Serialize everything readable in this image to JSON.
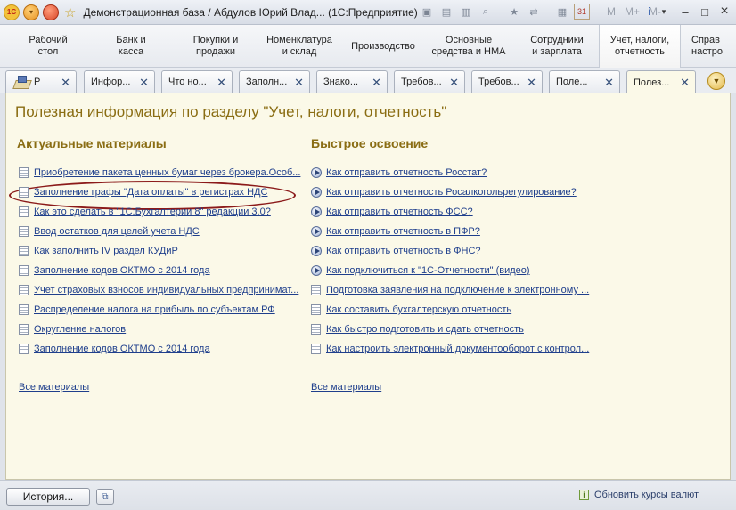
{
  "titlebar": {
    "title": "Демонстрационная база / Абдулов Юрий Влад...  (1С:Предприятие)",
    "logo": "1С",
    "tools_text": [
      "M",
      "M+",
      "M-"
    ],
    "calendar_day": "31",
    "info_glyph": "i"
  },
  "sections": [
    {
      "label": "Рабочий\nстол"
    },
    {
      "label": "Банк и\nкасса"
    },
    {
      "label": "Покупки и\nпродажи"
    },
    {
      "label": "Номенклатура\nи склад"
    },
    {
      "label": "Производство"
    },
    {
      "label": "Основные\nсредства и НМА"
    },
    {
      "label": "Сотрудники\nи зарплата"
    },
    {
      "label": "Учет, налоги,\nотчетность"
    },
    {
      "label": "Справ\nнастро"
    }
  ],
  "tabs": [
    {
      "label": "Р"
    },
    {
      "label": "Инфор..."
    },
    {
      "label": "Что но..."
    },
    {
      "label": "Заполн..."
    },
    {
      "label": "Знако..."
    },
    {
      "label": "Требов..."
    },
    {
      "label": "Требов..."
    },
    {
      "label": "Поле..."
    },
    {
      "label": "Полез..."
    }
  ],
  "page": {
    "title": "Полезная информация по разделу \"Учет, налоги, отчетность\"",
    "left_heading": "Актуальные материалы",
    "right_heading": "Быстрое освоение",
    "left_links": [
      "Приобретение пакета ценных бумаг через брокера.Особ...",
      "Заполнение графы \"Дата оплаты\"  в регистрах НДС",
      "Как это сделать в \"1С:Бухгалтерии 8\" редакции 3.0?",
      "Ввод остатков для целей учета НДС",
      "Как заполнить IV раздел КУДиР",
      "Заполнение кодов ОКТМО с 2014 года",
      "Учет страховых взносов индивидуальных предпринимат...",
      "Распределение налога на прибыль по субъектам РФ",
      "Округление налогов",
      "Заполнение кодов ОКТМО с 2014 года"
    ],
    "right_links": [
      {
        "text": "Как отправить отчетность Росстат?",
        "icon": "play"
      },
      {
        "text": "Как отправить отчетность Росалкогольрегулирование?",
        "icon": "play"
      },
      {
        "text": "Как отправить отчетность ФСС?",
        "icon": "play"
      },
      {
        "text": "Как отправить отчетность в ПФР?",
        "icon": "play"
      },
      {
        "text": "Как отправить отчетность в ФНС?",
        "icon": "play"
      },
      {
        "text": "Как подключиться к \"1С-Отчетности\" (видео)",
        "icon": "play"
      },
      {
        "text": "Подготовка заявления на подключение к электронному ...",
        "icon": "doc"
      },
      {
        "text": "Как составить бухгалтерскую отчетность",
        "icon": "doc"
      },
      {
        "text": "Как быстро подготовить и сдать отчетность",
        "icon": "doc"
      },
      {
        "text": "Как настроить электронный документооборот с контрол...",
        "icon": "doc"
      }
    ],
    "all_materials_left": "Все материалы",
    "all_materials_right": "Все материалы"
  },
  "bottom": {
    "history_label": "История...",
    "status_text": "Обновить курсы валют",
    "status_icon_glyph": "i"
  }
}
